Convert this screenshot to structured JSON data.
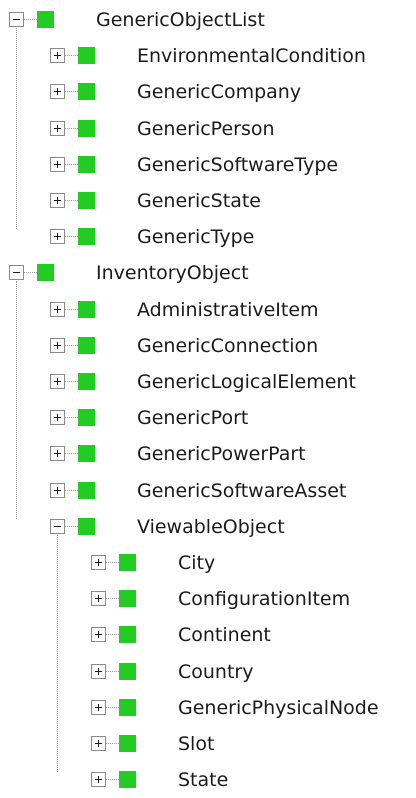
{
  "tree": {
    "node_color": "#22cc22",
    "nodes": [
      {
        "label": "GenericObjectList",
        "expanded": true,
        "children": [
          {
            "label": "EnvironmentalCondition",
            "expanded": false
          },
          {
            "label": "GenericCompany",
            "expanded": false
          },
          {
            "label": "GenericPerson",
            "expanded": false
          },
          {
            "label": "GenericSoftwareType",
            "expanded": false
          },
          {
            "label": "GenericState",
            "expanded": false
          },
          {
            "label": "GenericType",
            "expanded": false
          }
        ]
      },
      {
        "label": "InventoryObject",
        "expanded": true,
        "children": [
          {
            "label": "AdministrativeItem",
            "expanded": false
          },
          {
            "label": "GenericConnection",
            "expanded": false
          },
          {
            "label": "GenericLogicalElement",
            "expanded": false
          },
          {
            "label": "GenericPort",
            "expanded": false
          },
          {
            "label": "GenericPowerPart",
            "expanded": false
          },
          {
            "label": "GenericSoftwareAsset",
            "expanded": false
          },
          {
            "label": "ViewableObject",
            "expanded": true,
            "children": [
              {
                "label": "City",
                "expanded": false
              },
              {
                "label": "ConfigurationItem",
                "expanded": false
              },
              {
                "label": "Continent",
                "expanded": false
              },
              {
                "label": "Country",
                "expanded": false
              },
              {
                "label": "GenericPhysicalNode",
                "expanded": false
              },
              {
                "label": "Slot",
                "expanded": false
              },
              {
                "label": "State",
                "expanded": false
              }
            ]
          }
        ]
      }
    ]
  }
}
